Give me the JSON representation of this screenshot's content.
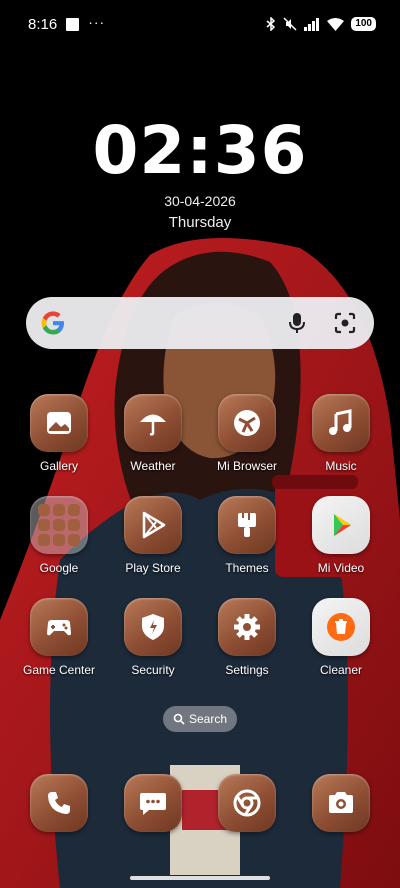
{
  "status_bar": {
    "time": "8:16",
    "dots": "···",
    "battery": "100"
  },
  "lockclock": {
    "time": "02:36",
    "date": "30-04-2026",
    "day": "Thursday"
  },
  "apps": [
    {
      "label": "Gallery",
      "icon": "gallery-icon"
    },
    {
      "label": "Weather",
      "icon": "umbrella-icon"
    },
    {
      "label": "Mi Browser",
      "icon": "browser-icon"
    },
    {
      "label": "Music",
      "icon": "music-note-icon"
    },
    {
      "label": "Google",
      "icon": "folder-icon"
    },
    {
      "label": "Play Store",
      "icon": "play-store-icon"
    },
    {
      "label": "Themes",
      "icon": "paintbrush-icon"
    },
    {
      "label": "Mi Video",
      "icon": "play-icon"
    },
    {
      "label": "Game Center",
      "icon": "gamepad-icon"
    },
    {
      "label": "Security",
      "icon": "shield-icon"
    },
    {
      "label": "Settings",
      "icon": "gear-icon"
    },
    {
      "label": "Cleaner",
      "icon": "trash-icon"
    }
  ],
  "page_search": {
    "label": "Search"
  },
  "dock": [
    {
      "name": "phone",
      "icon": "phone-icon"
    },
    {
      "name": "messages",
      "icon": "message-icon"
    },
    {
      "name": "chrome",
      "icon": "chrome-icon"
    },
    {
      "name": "camera",
      "icon": "camera-icon"
    }
  ],
  "colors": {
    "tile_accent": "#8e4f34",
    "dupatta_red": "#b3191d",
    "background": "#000000"
  }
}
